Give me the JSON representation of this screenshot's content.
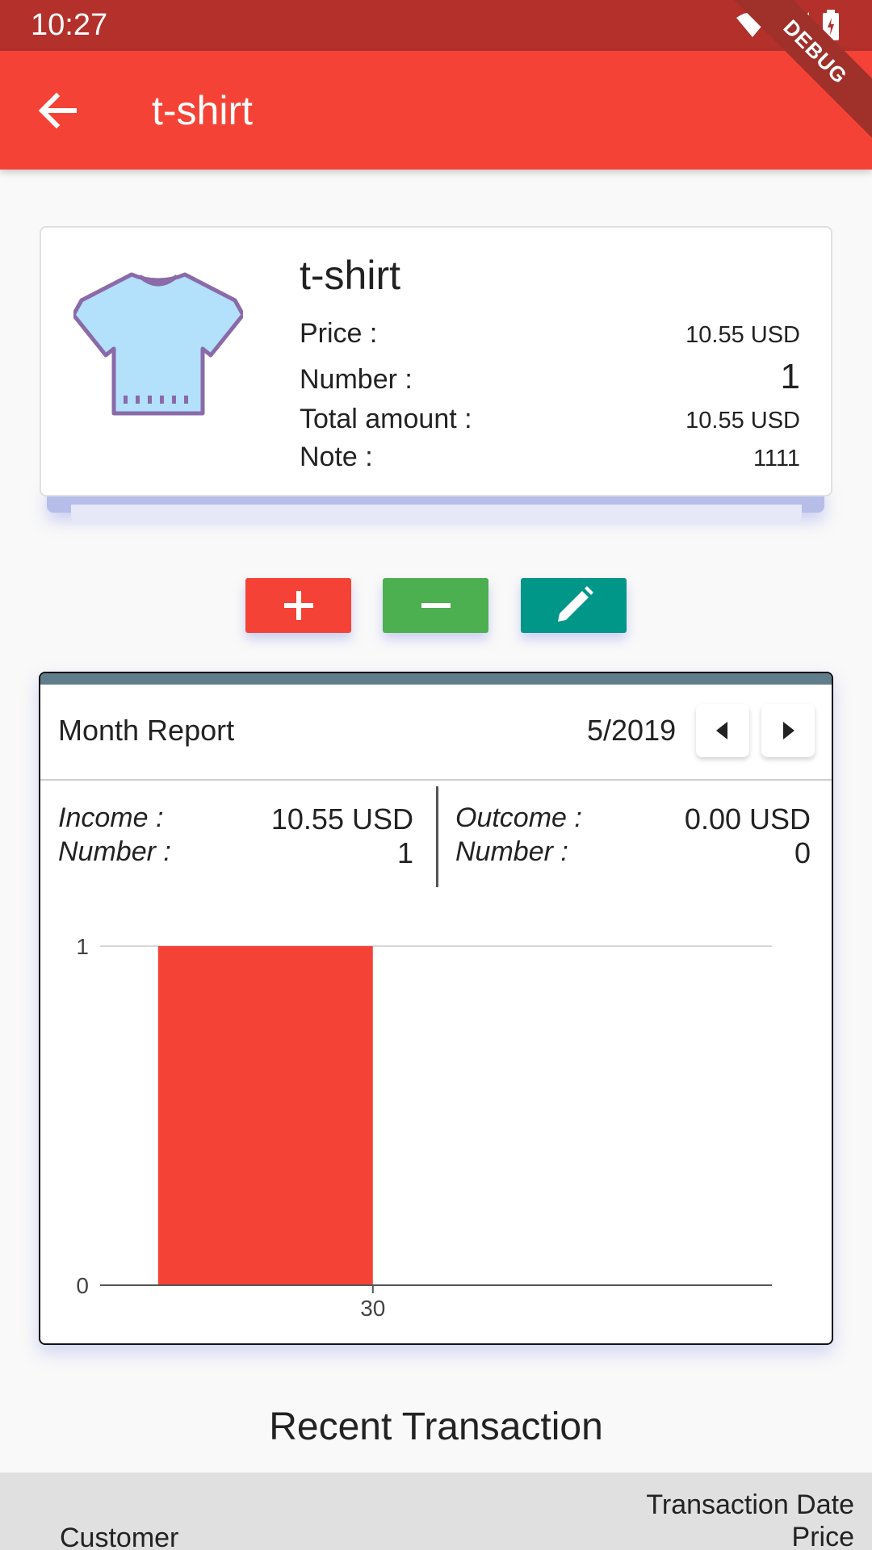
{
  "status_bar": {
    "time": "10:27"
  },
  "debug_banner": "DEBUG",
  "app_bar": {
    "title": "t-shirt"
  },
  "product": {
    "image_icon": "tshirt-icon",
    "name": "t-shirt",
    "price_label": "Price :",
    "price_value": "10.55 USD",
    "number_label": "Number :",
    "number_value": "1",
    "total_label": "Total amount :",
    "total_value": "10.55 USD",
    "note_label": "Note :",
    "note_value": "1111"
  },
  "actions": {
    "add_icon": "plus-icon",
    "remove_icon": "minus-icon",
    "edit_icon": "pencil-icon"
  },
  "report": {
    "title": "Month Report",
    "month": "5/2019",
    "income_label": "Income :",
    "income_value": "10.55 USD",
    "income_number_label": "Number :",
    "income_number_value": "1",
    "outcome_label": "Outcome :",
    "outcome_value": "0.00 USD",
    "outcome_number_label": "Number :",
    "outcome_number_value": "0"
  },
  "chart_data": {
    "type": "bar",
    "categories": [
      "30"
    ],
    "values": [
      1
    ],
    "ylim": [
      0,
      1
    ],
    "yticks": [
      "0",
      "1"
    ],
    "bar_color": "#f44336",
    "grid": true
  },
  "recent": {
    "title": "Recent Transaction",
    "col_customer": "Customer",
    "col_date": "Transaction Date",
    "col_price": "Price"
  },
  "colors": {
    "primary": "#f44336",
    "status": "#b3302b",
    "green": "#4caf50",
    "teal": "#009688",
    "slate": "#607d8b"
  }
}
